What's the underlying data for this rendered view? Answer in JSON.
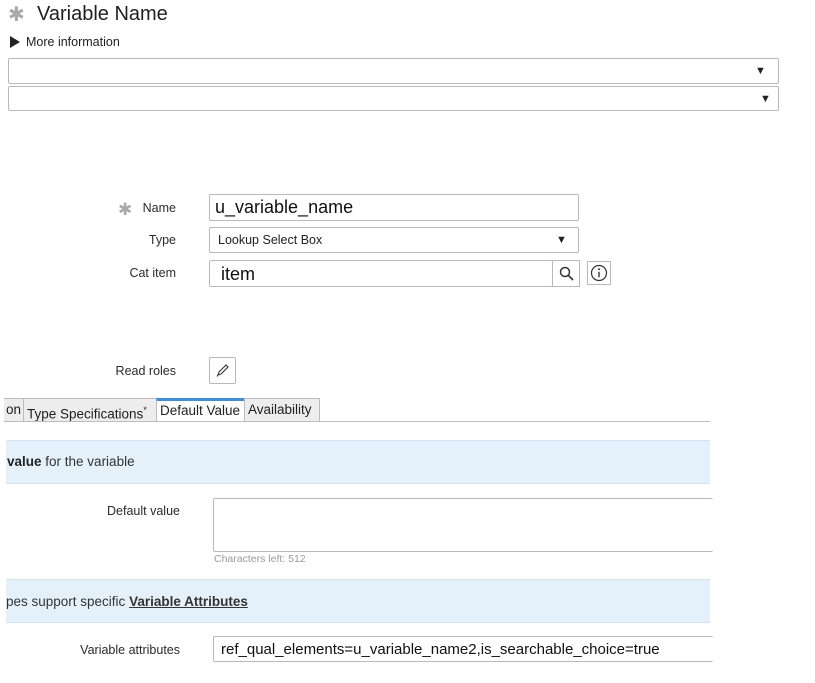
{
  "header": {
    "title": "Variable Name",
    "more_info": "More information"
  },
  "form": {
    "name_label": "Name",
    "name_value": "u_variable_name",
    "type_label": "Type",
    "type_value": "Lookup Select Box",
    "cat_item_label": "Cat item",
    "cat_item_value": "item",
    "read_roles_label": "Read roles"
  },
  "tabs": [
    {
      "label": "on"
    },
    {
      "label": "Type Specifications",
      "marker": "*"
    },
    {
      "label": "Default Value",
      "active": true
    },
    {
      "label": "Availability"
    }
  ],
  "default_value_section": {
    "heading_bold": "value",
    "heading_rest": " for the variable",
    "field_label": "Default value",
    "field_value": "",
    "characters_left": "Characters left: 512"
  },
  "attributes_section": {
    "heading_prefix": "pes support specific ",
    "heading_link": "Variable Attributes",
    "field_label": "Variable attributes",
    "field_value": "ref_qual_elements=u_variable_name2,is_searchable_choice=true"
  },
  "colors": {
    "accent": "#3f8fd2",
    "band": "#e5f1fa",
    "mandatory": "#a9a9a9"
  }
}
